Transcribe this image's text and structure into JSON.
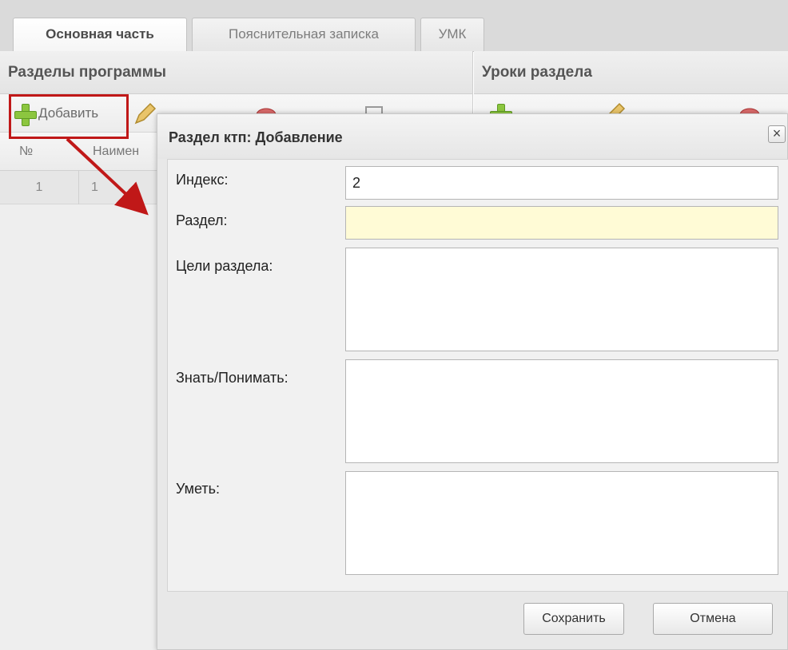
{
  "tabs": [
    {
      "label": "Основная часть",
      "active": true
    },
    {
      "label": "Пояснительная записка",
      "active": false
    },
    {
      "label": "УМК",
      "active": false
    }
  ],
  "left_panel": {
    "title": "Разделы программы",
    "toolbar": {
      "add_label": "Добавить"
    },
    "columns": [
      "№",
      "Наимен"
    ],
    "rows": [
      [
        "1",
        "1"
      ]
    ]
  },
  "right_panel": {
    "title": "Уроки раздела"
  },
  "dialog": {
    "title": "Раздел ктп: Добавление",
    "close_symbol": "×",
    "fields": {
      "index": {
        "label": "Индекс:",
        "value": "2"
      },
      "section": {
        "label": "Раздел:",
        "value": ""
      },
      "goals": {
        "label": "Цели раздела:",
        "value": ""
      },
      "know": {
        "label": "Знать/Понимать:",
        "value": ""
      },
      "can": {
        "label": "Уметь:",
        "value": ""
      }
    },
    "buttons": {
      "save": "Сохранить",
      "cancel": "Отмена"
    }
  },
  "colors": {
    "required_field": "#fffbd6",
    "annotation": "#c01818",
    "add_icon": "#8cc63f"
  },
  "icons": {
    "add": "plus-icon",
    "edit": "pencil-icon",
    "delete": "delete-icon",
    "close": "close-icon"
  }
}
